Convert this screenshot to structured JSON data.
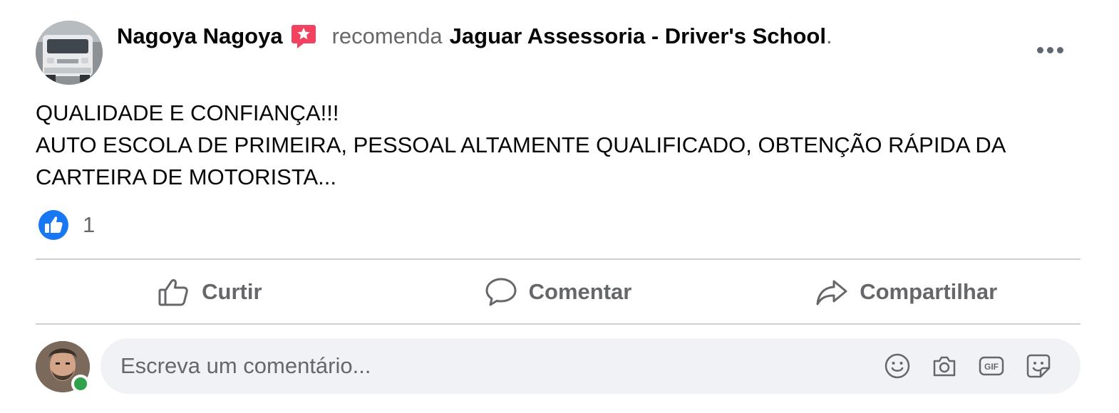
{
  "post": {
    "author": "Nagoya Nagoya",
    "recommend_verb": "recomenda",
    "page": "Jaguar Assessoria - Driver's School",
    "period": ".",
    "text_lines": [
      "QUALIDADE E CONFIANÇA!!!",
      "AUTO ESCOLA DE PRIMEIRA, PESSOAL ALTAMENTE QUALIFICADO, OBTENÇÃO RÁPIDA DA",
      "CARTEIRA DE MOTORISTA..."
    ],
    "reaction_count": "1"
  },
  "actions": {
    "like": "Curtir",
    "comment": "Comentar",
    "share": "Compartilhar"
  },
  "composer": {
    "placeholder": "Escreva um comentário..."
  },
  "icons": {
    "author_avatar": "van-photo-avatar",
    "badge": "recommend-star-icon",
    "more": "more-options-icon",
    "reaction": "like-reaction-icon",
    "like": "thumbs-up-icon",
    "comment": "comment-bubble-icon",
    "share": "share-arrow-icon",
    "emoji": "emoji-icon",
    "camera": "camera-icon",
    "gif": "gif-icon",
    "sticker": "sticker-icon"
  },
  "colors": {
    "text_primary": "#050505",
    "text_secondary": "#65676b",
    "like_blue": "#1877f2",
    "badge_red": "#f3425f",
    "online_green": "#31a24c",
    "input_bg": "#f0f2f5",
    "divider": "#ced0d4"
  }
}
